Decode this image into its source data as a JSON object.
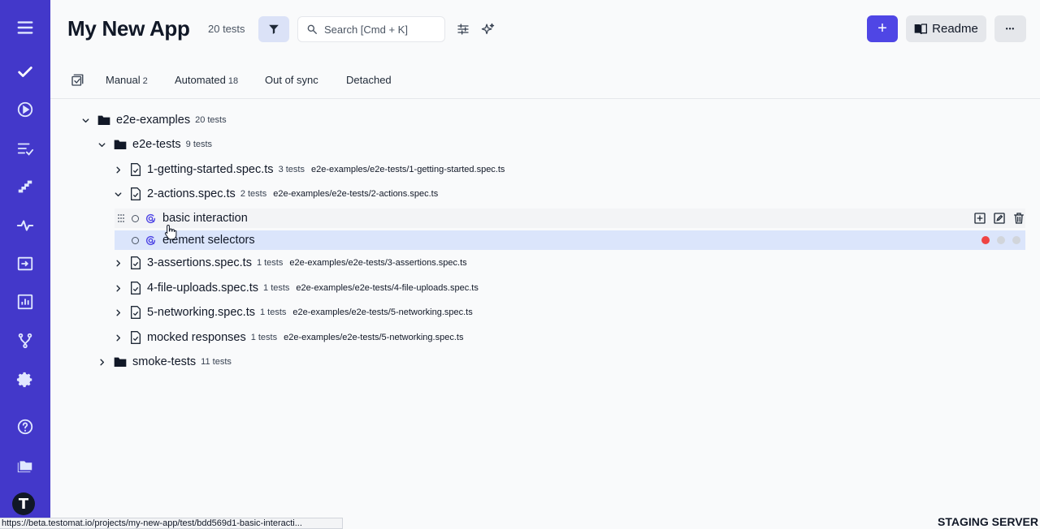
{
  "app": {
    "title": "My New App",
    "tests_count": "20 tests"
  },
  "search": {
    "placeholder": "Search [Cmd + K]"
  },
  "header": {
    "readme_label": "Readme",
    "add_label": "+",
    "more_label": "•••"
  },
  "tabs": [
    {
      "label": "Manual",
      "count": "2"
    },
    {
      "label": "Automated",
      "count": "18"
    },
    {
      "label": "Out of sync",
      "count": ""
    },
    {
      "label": "Detached",
      "count": ""
    }
  ],
  "tree": {
    "root": {
      "name": "e2e-examples",
      "count": "20 tests"
    },
    "suite": {
      "name": "e2e-tests",
      "count": "9 tests"
    },
    "files": [
      {
        "name": "1-getting-started.spec.ts",
        "count": "3 tests",
        "path": "e2e-examples/e2e-tests/1-getting-started.spec.ts"
      },
      {
        "name": "2-actions.spec.ts",
        "count": "2 tests",
        "path": "e2e-examples/e2e-tests/2-actions.spec.ts"
      },
      {
        "name": "3-assertions.spec.ts",
        "count": "1 tests",
        "path": "e2e-examples/e2e-tests/3-assertions.spec.ts"
      },
      {
        "name": "4-file-uploads.spec.ts",
        "count": "1 tests",
        "path": "e2e-examples/e2e-tests/4-file-uploads.spec.ts"
      },
      {
        "name": "5-networking.spec.ts",
        "count": "1 tests",
        "path": "e2e-examples/e2e-tests/5-networking.spec.ts"
      },
      {
        "name": "mocked responses",
        "count": "1 tests",
        "path": "e2e-examples/e2e-tests/5-networking.spec.ts"
      }
    ],
    "tests": [
      {
        "name": "basic interaction"
      },
      {
        "name": "element selectors"
      }
    ],
    "smoke": {
      "name": "smoke-tests",
      "count": "11 tests"
    }
  },
  "status_bar": {
    "url": "https://beta.testomat.io/projects/my-new-app/test/bdd569d1-basic-interacti...",
    "server_label": "STAGING SERVER"
  },
  "colors": {
    "sidebar": "#4338ca",
    "accent": "#4f46e5",
    "selected_row": "#dbe5fb",
    "dot_red": "#ef4444",
    "dot_gray": "#d1d5db"
  }
}
